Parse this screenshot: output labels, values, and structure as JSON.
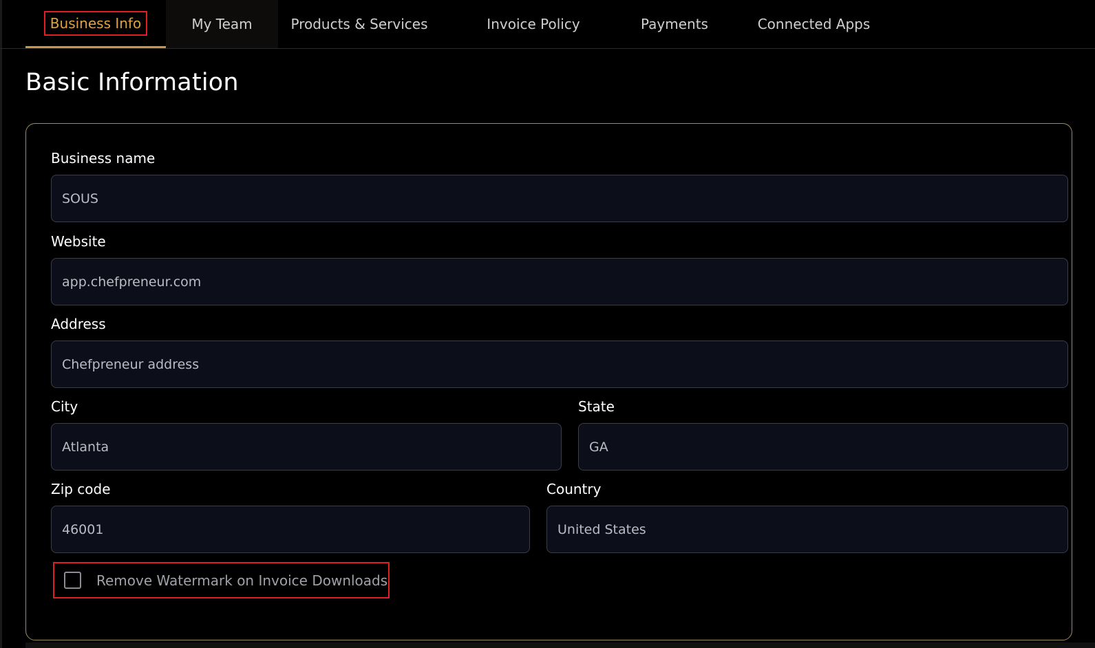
{
  "tabs": [
    {
      "label": "Business Info",
      "active": true
    },
    {
      "label": "My Team",
      "active": false
    },
    {
      "label": "Products & Services",
      "active": false
    },
    {
      "label": "Invoice Policy",
      "active": false
    },
    {
      "label": "Payments",
      "active": false
    },
    {
      "label": "Connected Apps",
      "active": false
    }
  ],
  "page_title": "Basic Information",
  "form": {
    "business_name": {
      "label": "Business name",
      "value": "SOUS"
    },
    "website": {
      "label": "Website",
      "value": "app.chefpreneur.com"
    },
    "address": {
      "label": "Address",
      "value": "Chefpreneur address"
    },
    "city": {
      "label": "City",
      "value": "Atlanta"
    },
    "state": {
      "label": "State",
      "value": "GA"
    },
    "zip": {
      "label": "Zip code",
      "value": "46001"
    },
    "country": {
      "label": "Country",
      "value": "United States"
    },
    "watermark": {
      "label": "Remove Watermark on Invoice Downloads",
      "checked": false
    }
  },
  "colors": {
    "accent": "#e1a244",
    "highlight": "#e01e26",
    "card_border": "#a08a5e",
    "input_bg": "#0c0f19"
  }
}
